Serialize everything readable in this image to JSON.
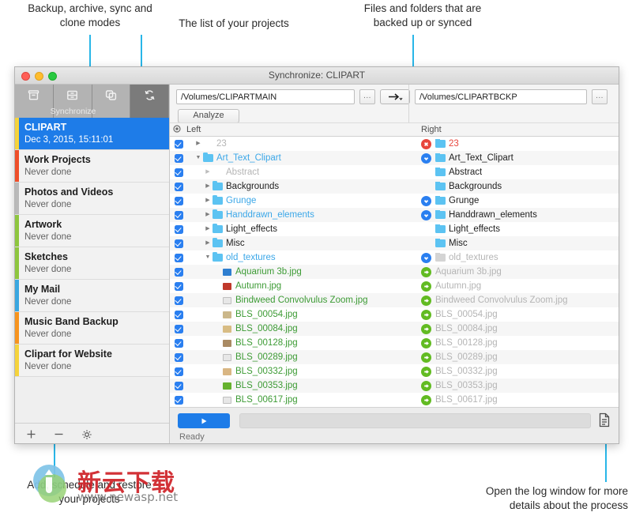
{
  "annotations": {
    "modes": "Backup, archive, sync and\nclone modes",
    "projects": "The list of your projects",
    "files": "Files and folders that are\nbacked up or synced",
    "add_projects": "Add, schedule and restore\nyour projects",
    "log": "Open the log window for more\ndetails about the process"
  },
  "window": {
    "title": "Synchronize: CLIPART",
    "modes": {
      "label": "Synchronize",
      "items": [
        {
          "name": "archive-mode",
          "icon": "archive-icon",
          "selected": false
        },
        {
          "name": "backup-mode",
          "icon": "backup-icon",
          "selected": false
        },
        {
          "name": "clone-mode",
          "icon": "clone-icon",
          "selected": false
        },
        {
          "name": "synchronize-mode",
          "icon": "sync-icon",
          "selected": true
        }
      ]
    }
  },
  "sidebar": {
    "projects": [
      {
        "name": "CLIPART",
        "status": "Dec 3, 2015, 15:11:01",
        "color": "#f5d33c",
        "active": true
      },
      {
        "name": "Work Projects",
        "status": "Never done",
        "color": "#ef4f2a",
        "active": false
      },
      {
        "name": "Photos and Videos",
        "status": "Never done",
        "color": "#b9b9b9",
        "active": false
      },
      {
        "name": "Artwork",
        "status": "Never done",
        "color": "#8ec63f",
        "active": false
      },
      {
        "name": "Sketches",
        "status": "Never done",
        "color": "#8ec63f",
        "active": false
      },
      {
        "name": "My Mail",
        "status": "Never done",
        "color": "#3aa7e0",
        "active": false
      },
      {
        "name": "Music Band Backup",
        "status": "Never done",
        "color": "#f7941e",
        "active": false
      },
      {
        "name": "Clipart for Website",
        "status": "Never done",
        "color": "#f5d33c",
        "active": false
      }
    ],
    "footer": {
      "add": "add-project-icon",
      "remove": "remove-project-icon",
      "settings": "project-settings-icon"
    }
  },
  "main": {
    "left_path": "/Volumes/CLIPARTMAIN",
    "right_path": "/Volumes/CLIPARTBCKP",
    "browse_label": "...",
    "direction_icon": "arrow-right-icon",
    "analyze_label": "Analyze",
    "column_left": "Left",
    "column_right": "Right",
    "rows": [
      {
        "name": "23",
        "type": "folder",
        "indent": 1,
        "twisty": "collapsed",
        "left_color": "gray",
        "left_folder": false,
        "right_name": "23",
        "right_color": "red",
        "badge": "delete"
      },
      {
        "name": "Art_Text_Clipart",
        "type": "folder",
        "indent": 1,
        "twisty": "expanded",
        "left_color": "blue",
        "left_folder": true,
        "right_name": "Art_Text_Clipart",
        "right_color": "black",
        "badge": "down"
      },
      {
        "name": "Abstract",
        "type": "folder",
        "indent": 2,
        "twisty": "collapsed-dim",
        "left_color": "gray",
        "left_folder": false,
        "right_name": "Abstract",
        "right_color": "black",
        "badge": "none"
      },
      {
        "name": "Backgrounds",
        "type": "folder",
        "indent": 2,
        "twisty": "collapsed",
        "left_color": "black",
        "left_folder": true,
        "right_name": "Backgrounds",
        "right_color": "black",
        "badge": "none"
      },
      {
        "name": "Grunge",
        "type": "folder",
        "indent": 2,
        "twisty": "collapsed",
        "left_color": "blue",
        "left_folder": true,
        "right_name": "Grunge",
        "right_color": "black",
        "badge": "down"
      },
      {
        "name": "Handdrawn_elements",
        "type": "folder",
        "indent": 2,
        "twisty": "collapsed",
        "left_color": "blue",
        "left_folder": true,
        "right_name": "Handdrawn_elements",
        "right_color": "black",
        "badge": "down"
      },
      {
        "name": "Light_effects",
        "type": "folder",
        "indent": 2,
        "twisty": "collapsed",
        "left_color": "black",
        "left_folder": true,
        "right_name": "Light_effects",
        "right_color": "black",
        "badge": "none"
      },
      {
        "name": "Misc",
        "type": "folder",
        "indent": 2,
        "twisty": "collapsed",
        "left_color": "black",
        "left_folder": true,
        "right_name": "Misc",
        "right_color": "black",
        "badge": "none"
      },
      {
        "name": "old_textures",
        "type": "folder",
        "indent": 2,
        "twisty": "expanded",
        "left_color": "blue",
        "left_folder": true,
        "right_name": "old_textures",
        "right_color": "gray",
        "badge": "down"
      },
      {
        "name": "Aquarium 3b.jpg",
        "type": "file",
        "indent": 3,
        "twisty": "none",
        "left_color": "green",
        "thumb": "#2f7fd0",
        "right_name": "Aquarium 3b.jpg",
        "right_color": "gray",
        "badge": "copy-right"
      },
      {
        "name": "Autumn.jpg",
        "type": "file",
        "indent": 3,
        "twisty": "none",
        "left_color": "green",
        "thumb": "#c0392b",
        "right_name": "Autumn.jpg",
        "right_color": "gray",
        "badge": "copy-right"
      },
      {
        "name": "Bindweed Convolvulus Zoom.jpg",
        "type": "file",
        "indent": 3,
        "twisty": "none",
        "left_color": "green",
        "thumb": "generic",
        "right_name": "Bindweed Convolvulus Zoom.jpg",
        "right_color": "gray",
        "badge": "copy-right"
      },
      {
        "name": "BLS_00054.jpg",
        "type": "file",
        "indent": 3,
        "twisty": "none",
        "left_color": "green",
        "thumb": "#cbb78a",
        "right_name": "BLS_00054.jpg",
        "right_color": "gray",
        "badge": "copy-right"
      },
      {
        "name": "BLS_00084.jpg",
        "type": "file",
        "indent": 3,
        "twisty": "none",
        "left_color": "green",
        "thumb": "#d8bc84",
        "right_name": "BLS_00084.jpg",
        "right_color": "gray",
        "badge": "copy-right"
      },
      {
        "name": "BLS_00128.jpg",
        "type": "file",
        "indent": 3,
        "twisty": "none",
        "left_color": "green",
        "thumb": "#a98a63",
        "right_name": "BLS_00128.jpg",
        "right_color": "gray",
        "badge": "copy-right"
      },
      {
        "name": "BLS_00289.jpg",
        "type": "file",
        "indent": 3,
        "twisty": "none",
        "left_color": "green",
        "thumb": "generic",
        "right_name": "BLS_00289.jpg",
        "right_color": "gray",
        "badge": "copy-right"
      },
      {
        "name": "BLS_00332.jpg",
        "type": "file",
        "indent": 3,
        "twisty": "none",
        "left_color": "green",
        "thumb": "#d9b683",
        "right_name": "BLS_00332.jpg",
        "right_color": "gray",
        "badge": "copy-right"
      },
      {
        "name": "BLS_00353.jpg",
        "type": "file",
        "indent": 3,
        "twisty": "none",
        "left_color": "green",
        "thumb": "#66b22e",
        "right_name": "BLS_00353.jpg",
        "right_color": "gray",
        "badge": "copy-right"
      },
      {
        "name": "BLS_00617.jpg",
        "type": "file",
        "indent": 3,
        "twisty": "none",
        "left_color": "green",
        "thumb": "generic",
        "right_name": "BLS_00617.jpg",
        "right_color": "gray",
        "badge": "copy-right"
      }
    ],
    "bottom": {
      "run_icon": "play-icon",
      "status": "Ready",
      "log_icon": "log-document-icon"
    }
  },
  "watermark": {
    "chinese": "新云下载",
    "url": "www.newasp.net"
  }
}
